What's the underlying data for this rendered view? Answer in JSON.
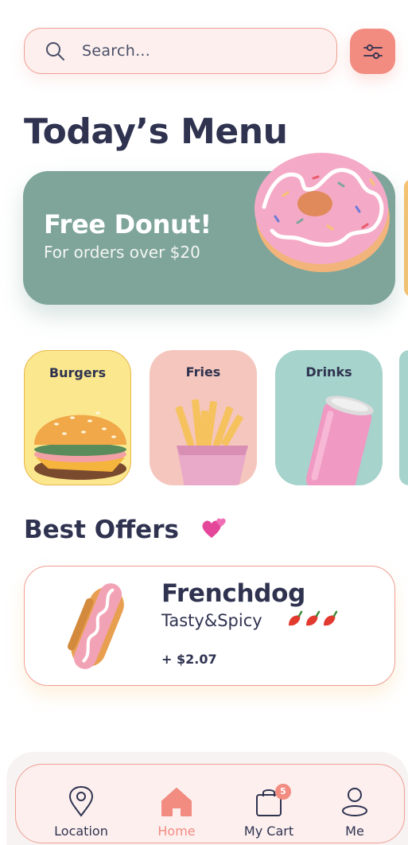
{
  "search": {
    "placeholder": "Search..."
  },
  "title": "Today’s Menu",
  "promo": {
    "headline": "Free Donut!",
    "subtitle": "For orders over $20"
  },
  "categories": [
    {
      "label": "Burgers"
    },
    {
      "label": "Fries"
    },
    {
      "label": "Drinks"
    }
  ],
  "offers": {
    "heading": "Best Offers",
    "heading_emoji": "two-hearts-icon",
    "items": [
      {
        "name": "Frenchdog",
        "description": "Tasty&Spicy",
        "spice_icon": "chili-pepper-icon",
        "spice_level": 3,
        "price": "+ $2.07"
      }
    ]
  },
  "nav": {
    "items": [
      {
        "label": "Location",
        "icon": "location-pin-icon"
      },
      {
        "label": "Home",
        "icon": "home-icon",
        "active": true
      },
      {
        "label": "My Cart",
        "icon": "shopping-bag-icon",
        "badge": "5"
      },
      {
        "label": "Me",
        "icon": "user-icon"
      }
    ]
  },
  "colors": {
    "accent": "#f28b80",
    "text": "#2f3350",
    "promo_bg": "#7fa59a",
    "burgers_bg": "#fbe88e",
    "fries_bg": "#f5c6bd",
    "drinks_bg": "#a6d3cc"
  }
}
